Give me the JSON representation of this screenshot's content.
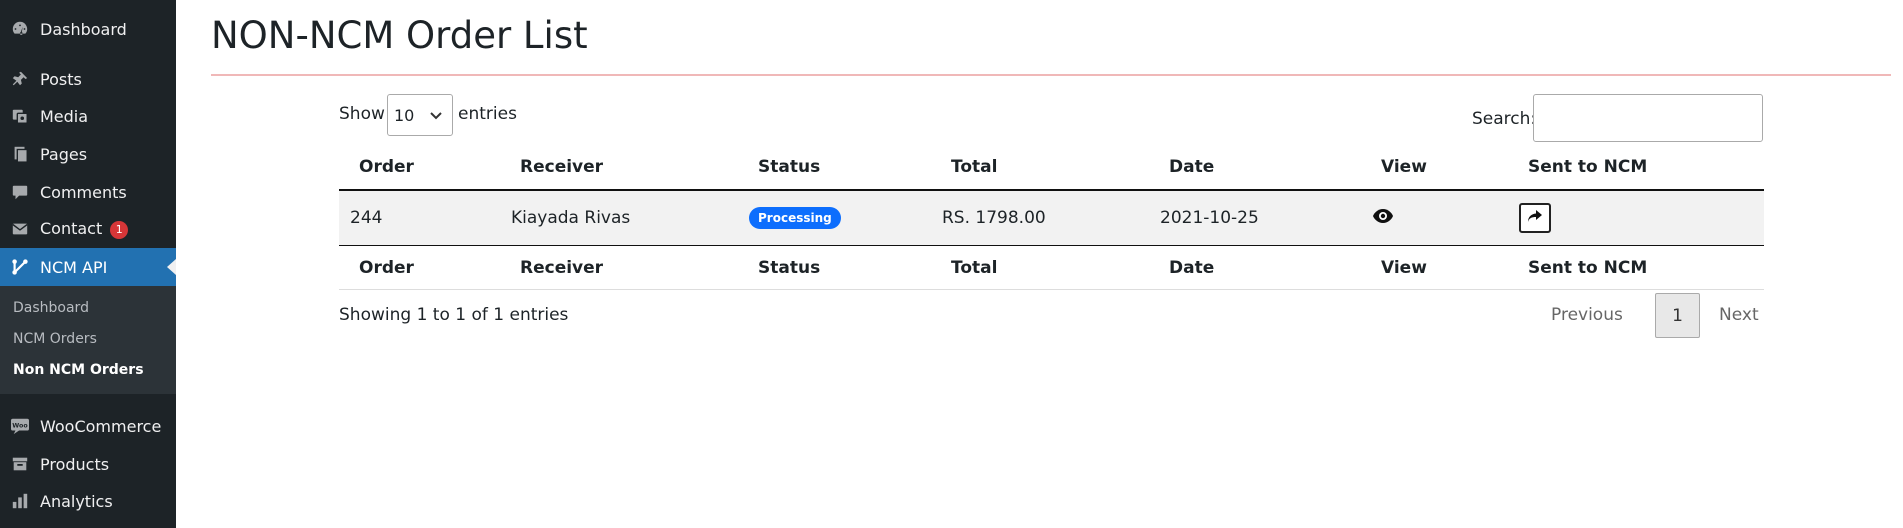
{
  "sidebar": {
    "menu": [
      {
        "label": "Dashboard",
        "icon": "dashboard-gauge-icon"
      },
      {
        "label": "Posts",
        "icon": "pushpin-icon"
      },
      {
        "label": "Media",
        "icon": "media-icon"
      },
      {
        "label": "Pages",
        "icon": "pages-icon"
      },
      {
        "label": "Comments",
        "icon": "comment-bubble-icon"
      },
      {
        "label": "Contact",
        "icon": "envelope-icon",
        "badge": "1"
      },
      {
        "label": "NCM API",
        "icon": "ncm-api-icon",
        "active": true
      },
      {
        "label": "WooCommerce",
        "icon": "woocommerce-icon"
      },
      {
        "label": "Products",
        "icon": "archive-box-icon"
      },
      {
        "label": "Analytics",
        "icon": "bar-chart-icon"
      }
    ],
    "submenu": [
      "Dashboard",
      "NCM Orders",
      "Non NCM Orders"
    ],
    "colors": {
      "background": "#1d2327",
      "active": "#2271b1",
      "badge": "#d63638"
    }
  },
  "page": {
    "title": "NON-NCM Order List"
  },
  "table_controls": {
    "show_label": "Show",
    "entries_label": "entries",
    "page_length": "10",
    "search_label": "Search:",
    "search_value": ""
  },
  "table": {
    "columns": [
      "Order",
      "Receiver",
      "Status",
      "Total",
      "Date",
      "View",
      "Sent to NCM"
    ],
    "rows": [
      {
        "order": "244",
        "receiver": "Kiayada Rivas",
        "status": "Processing",
        "total": "RS. 1798.00",
        "date": "2021-10-25"
      }
    ],
    "status_color": "#0d6efd"
  },
  "footer": {
    "info": "Showing 1 to 1 of 1 entries",
    "previous": "Previous",
    "current_page": "1",
    "next": "Next"
  }
}
